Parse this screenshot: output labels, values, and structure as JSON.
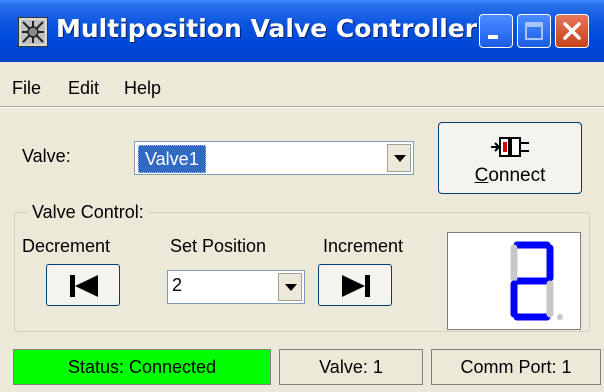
{
  "window": {
    "title": "Multiposition Valve Controller",
    "icons": [
      "app-icon",
      "minimize-icon",
      "maximize-icon",
      "close-icon"
    ]
  },
  "menu": {
    "items": [
      {
        "label": "File"
      },
      {
        "label": "Edit"
      },
      {
        "label": "Help"
      }
    ]
  },
  "valve": {
    "label": "Valve:",
    "selected": "Valve1"
  },
  "connect": {
    "label": "Connect",
    "icon": "plug-icon"
  },
  "valve_control": {
    "title": "Valve Control:",
    "decrement_label": "Decrement",
    "set_position_label": "Set Position",
    "increment_label": "Increment",
    "position_value": "2",
    "display_digit": "2",
    "display_color": "#0000ff"
  },
  "status": {
    "connection": "Status: Connected",
    "valve": "Valve: 1",
    "comm_port": "Comm Port: 1",
    "connected_color": "#00ff00"
  }
}
